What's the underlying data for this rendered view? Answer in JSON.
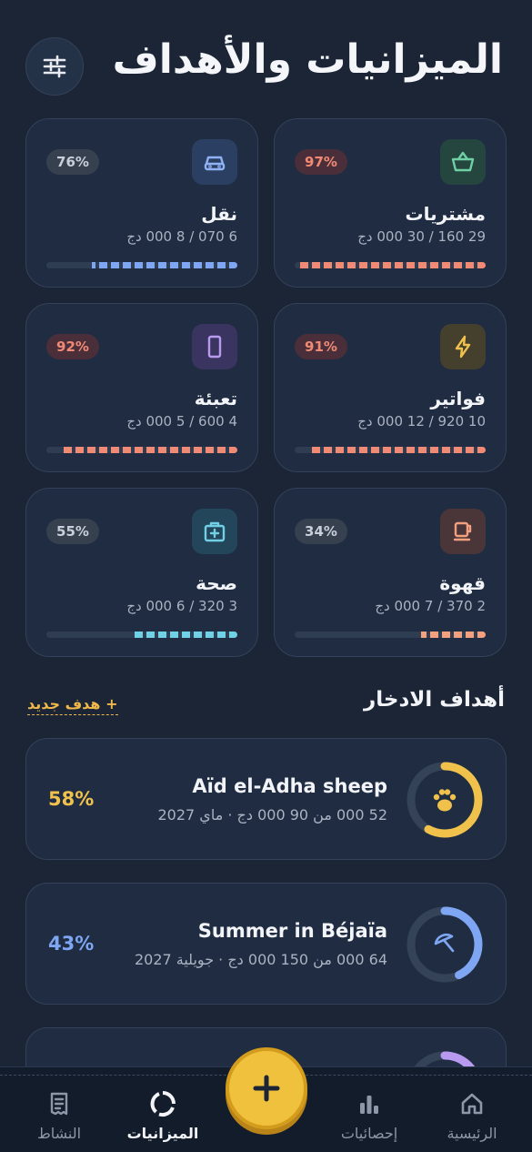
{
  "header": {
    "title": "الميزانيات والأهداف"
  },
  "budgets": [
    {
      "name": "مشتريات",
      "amount": "29 160 / 30 000 دج",
      "percent_label": "97%",
      "progress": 0.97,
      "color": "#f08a74",
      "icon": "basket-icon"
    },
    {
      "name": "نقل",
      "amount": "6 070 / 8 000 دج",
      "percent_label": "76%",
      "progress": 0.76,
      "color": "#7ea6f2",
      "icon": "car-icon"
    },
    {
      "name": "فواتير",
      "amount": "10 920 / 12 000 دج",
      "percent_label": "91%",
      "progress": 0.91,
      "color": "#f08a74",
      "icon": "bolt-icon"
    },
    {
      "name": "تعبئة",
      "amount": "4 600 / 5 000 دج",
      "percent_label": "92%",
      "progress": 0.92,
      "color": "#f08a74",
      "icon": "phone-icon"
    },
    {
      "name": "قهوة",
      "amount": "2 370 / 7 000 دج",
      "percent_label": "34%",
      "progress": 0.34,
      "color": "#f2a07e",
      "icon": "coffee-icon"
    },
    {
      "name": "صحة",
      "amount": "3 320 / 6 000 دج",
      "percent_label": "55%",
      "progress": 0.55,
      "color": "#6fd0e6",
      "icon": "medkit-icon"
    }
  ],
  "goals_section": {
    "title": "أهداف الادخار",
    "new_goal_label": "+ هدف جديد"
  },
  "goals": [
    {
      "name": "Aïd el-Adha sheep",
      "meta": "52 000 من 90 000 دج · ماي 2027",
      "percent_label": "58%",
      "progress": 0.58,
      "color": "#f0c24c",
      "icon": "paw-icon"
    },
    {
      "name": "Summer in Béjaïa",
      "meta": "64 000 من 150 000 دج · جويلية 2027",
      "percent_label": "43%",
      "progress": 0.43,
      "color": "#7ea6f2",
      "icon": "umbrella-icon"
    },
    {
      "progress": 0.3,
      "color": "#b89af0"
    }
  ],
  "nav": {
    "home": "الرئيسية",
    "stats": "إحصائيات",
    "budgets": "الميزانيات",
    "activity": "النشاط"
  },
  "colors": {
    "background": "#1b2535",
    "card": "#1f2c41",
    "accent": "#f0c13c",
    "danger": "#f08a74"
  }
}
